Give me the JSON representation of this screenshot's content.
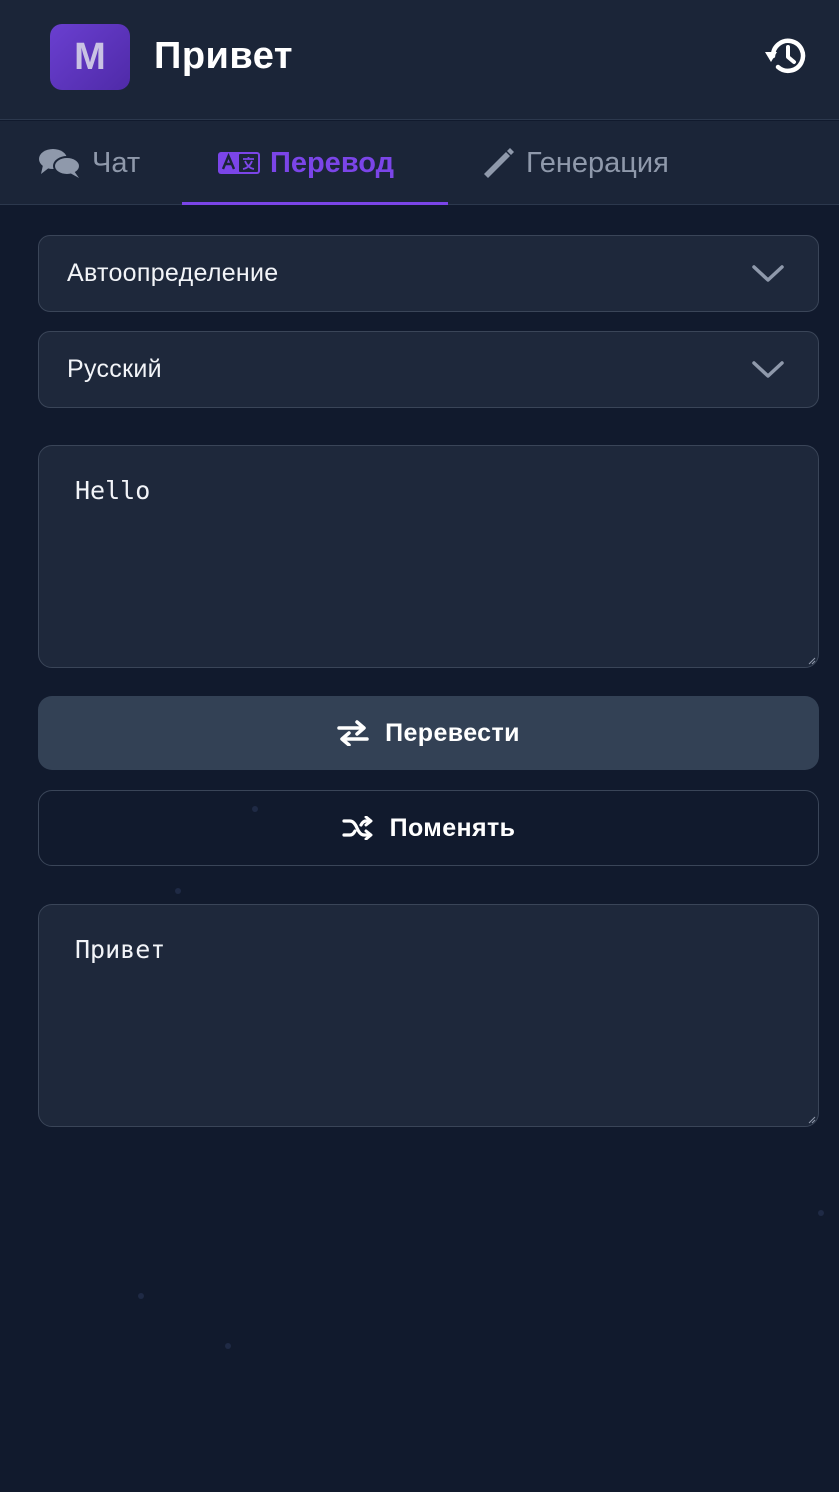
{
  "header": {
    "logo_letter": "M",
    "title": "Привет",
    "history_icon": "history-icon"
  },
  "tabs": [
    {
      "label": "Чат",
      "icon": "comments-icon",
      "active": false
    },
    {
      "label": "Перевод",
      "icon": "language-icon",
      "active": true
    },
    {
      "label": "Генерация",
      "icon": "pencil-icon",
      "active": false
    }
  ],
  "translate": {
    "source_language": "Автоопределение",
    "target_language": "Русский",
    "input_text": "Hello",
    "translate_button": "Перевести",
    "swap_button": "Поменять",
    "output_text": "Привет"
  },
  "colors": {
    "background": "#111a2d",
    "panel": "#1b2538",
    "field": "#1e283b",
    "accent": "#7b45e8",
    "primary_button": "#334155"
  }
}
